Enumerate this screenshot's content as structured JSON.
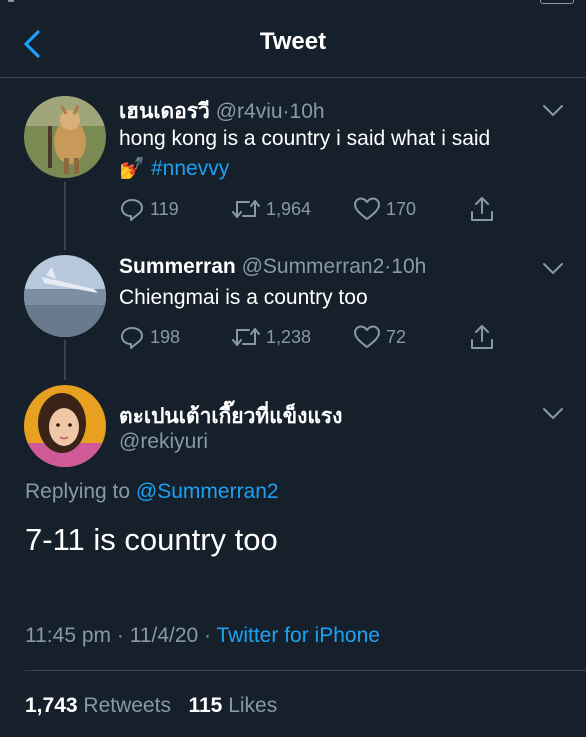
{
  "header": {
    "title": "Tweet",
    "back_icon": "chevron-left-icon"
  },
  "colors": {
    "background": "#15202b",
    "accent": "#1da1f2",
    "muted": "#8899a6",
    "divider": "#38444d"
  },
  "tweets": [
    {
      "name": "เฮนเดอรวี",
      "handle": "@r4viu",
      "time": "10h",
      "text": "hong kong is a country i said what i said",
      "emoji": "💅",
      "hashtag": "#nnevvy",
      "replies": "119",
      "retweets": "1,964",
      "likes": "170"
    },
    {
      "name": "Summerran",
      "handle": "@Summerran2",
      "time": "10h",
      "text": "Chiengmai is a country too",
      "replies": "198",
      "retweets": "1,238",
      "likes": "72"
    }
  ],
  "main": {
    "name": "ตะเปนเต้าเกี๊ยวที่แข็งแรง",
    "handle": "@rekiyuri",
    "replying_prefix": "Replying to",
    "replying_to": "@Summerran2",
    "text": "7-11 is country too",
    "time": "11:45 pm",
    "date": "11/4/20",
    "source": "Twitter for iPhone",
    "retweet_count": "1,743",
    "retweet_label": "Retweets",
    "like_count": "115",
    "like_label": "Likes"
  }
}
